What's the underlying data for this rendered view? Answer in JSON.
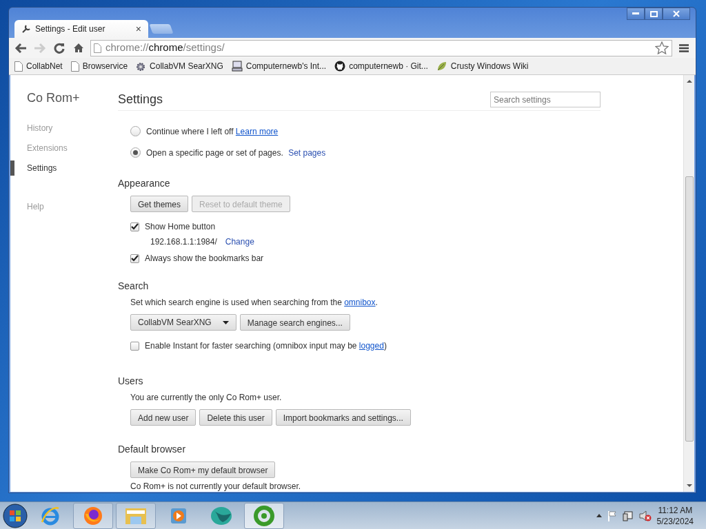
{
  "tabs": [
    {
      "label": "Settings - Edit user",
      "selected": true,
      "close": "×"
    }
  ],
  "address_bar": {
    "scheme": "chrome://",
    "host": "chrome",
    "path": "/settings/"
  },
  "bookmarks": [
    {
      "label": "CollabNet",
      "kind": "page"
    },
    {
      "label": "Browservice",
      "kind": "page"
    },
    {
      "label": "CollabVM SearXNG",
      "kind": "gear"
    },
    {
      "label": "Computernewb's Int...",
      "kind": "computer"
    },
    {
      "label": "computernewb · Git...",
      "kind": "github"
    },
    {
      "label": "Crusty Windows Wiki",
      "kind": "leaf"
    }
  ],
  "sidebar": {
    "title": "Co Rom+",
    "items": [
      {
        "label": "History",
        "selected": false
      },
      {
        "label": "Extensions",
        "selected": false
      },
      {
        "label": "Settings",
        "selected": true
      },
      {
        "label": "Help",
        "selected": false
      }
    ]
  },
  "page": {
    "title": "Settings",
    "search": {
      "placeholder": "Search settings"
    }
  },
  "on_startup": {
    "options": [
      {
        "label": "Continue where I left off",
        "link": "Learn more",
        "link_underlined": true,
        "selected": false
      },
      {
        "label": "Open a specific page or set of pages.",
        "link": "Set pages",
        "link_underlined": false,
        "selected": true
      }
    ]
  },
  "appearance": {
    "heading": "Appearance",
    "buttons": [
      {
        "label": "Get themes",
        "disabled": false
      },
      {
        "label": "Reset to default theme",
        "disabled": true
      }
    ],
    "show_home": {
      "label": "Show Home button",
      "checked": true
    },
    "home_page": {
      "url": "192.168.1.1:1984/",
      "link": "Change"
    },
    "bookmarks_bar": {
      "label": "Always show the bookmarks bar",
      "checked": true
    }
  },
  "search": {
    "heading": "Search",
    "description": "Set which search engine is used when searching from the ",
    "description_link": "omnibox",
    "description_end": ".",
    "engine": "CollabVM SearXNG",
    "manage_button": "Manage search engines...",
    "instant": {
      "label": "Enable Instant for faster searching (omnibox input may be ",
      "link": "logged",
      "end": ")",
      "checked": false
    }
  },
  "users": {
    "heading": "Users",
    "description": "You are currently the only Co Rom+ user.",
    "buttons": [
      "Add new user",
      "Delete this user",
      "Import bookmarks and settings..."
    ]
  },
  "default_browser": {
    "heading": "Default browser",
    "button": "Make Co Rom+ my default browser",
    "status": "Co Rom+ is not currently your default browser."
  },
  "taskbar": {
    "apps": [
      {
        "kind": "ie",
        "running": false,
        "active": false
      },
      {
        "kind": "firefox",
        "running": true,
        "active": false
      },
      {
        "kind": "folder",
        "running": true,
        "active": false
      },
      {
        "kind": "media",
        "running": false,
        "active": false
      },
      {
        "kind": "globe",
        "running": false,
        "active": false
      },
      {
        "kind": "chromium",
        "running": true,
        "active": true
      }
    ],
    "time": "11:12 AM",
    "date": "5/23/2024"
  }
}
